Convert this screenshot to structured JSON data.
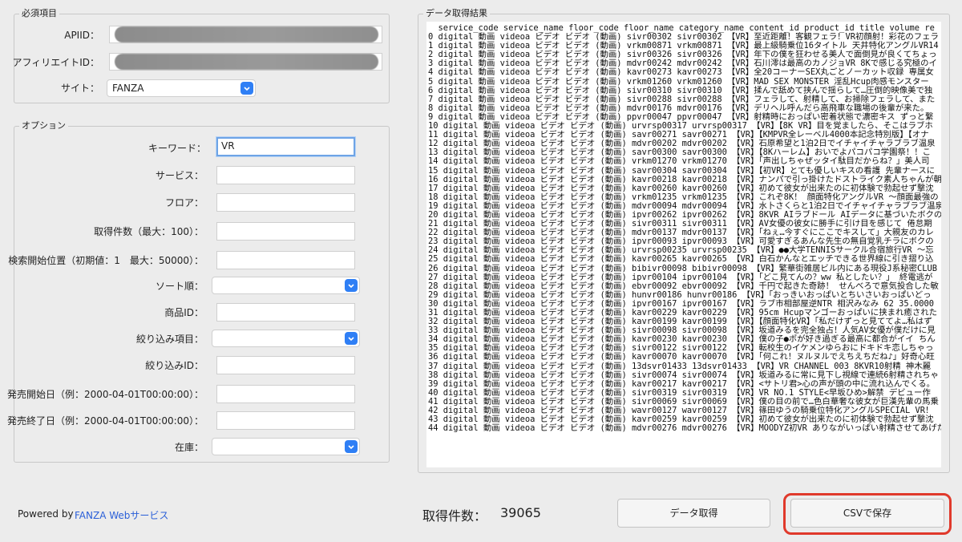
{
  "required": {
    "title": "必須項目",
    "apiid_label": "APIID：",
    "affiliate_label": "アフィリエイトID：",
    "site_label": "サイト：",
    "site_value": "FANZA"
  },
  "options": {
    "title": "オプション",
    "keyword_label": "キーワード：",
    "keyword_value": "VR",
    "service_label": "サービス：",
    "floor_label": "フロア：",
    "count_label": "取得件数（最大：100）：",
    "offset_label": "検索開始位置（初期値：1　最大：50000）：",
    "sort_label": "ソート順：",
    "product_id_label": "商品ID：",
    "filter_item_label": "絞り込み項目：",
    "filter_id_label": "絞り込みID：",
    "date_start_label": "発売開始日（例：2000-04-01T00:00:00）：",
    "date_end_label": "発売終了日（例：2000-04-01T00:00:00）：",
    "stock_label": "在庫："
  },
  "results": {
    "title": "データ取得結果",
    "header": "  service_code service_name floor_code floor_name category_name content_id product_id title volume re",
    "rows": [
      "0 digital 動画 videoa ビデオ ビデオ (動画) sivr00302 sivr00302 【VR】至近距離！客観フェラ！VR初顔射！彩花のフェラ",
      "1 digital 動画 videoa ビデオ ビデオ (動画) vrkm00871 vrkm00871 【VR】最上級騎乗位16タイトル 天井特化アングルVR14",
      "2 digital 動画 videoa ビデオ ビデオ (動画) sivr00326 sivr00326 【VR】年下の僕を狂わせる美人で面倒見が良くてちょっ",
      "3 digital 動画 videoa ビデオ ビデオ (動画) mdvr00242 mdvr00242 【VR】石川澪は最高のカノジョVR 8Kで感じる究極のイ",
      "4 digital 動画 videoa ビデオ ビデオ (動画) kavr00273 kavr00273 【VR】全20コーナーSEX丸ごとノーカット収録 専属女",
      "5 digital 動画 videoa ビデオ ビデオ (動画) vrkm01260 vrkm01260 【VR】MAD SEX MONSTER 淫乱Hcup肉感モンスター",
      "6 digital 動画 videoa ビデオ ビデオ (動画) sivr00310 sivr00310 【VR】揉んで舐めて挟んで揺らして…圧倒的映像美で独",
      "7 digital 動画 videoa ビデオ ビデオ (動画) sivr00288 sivr00288 【VR】フェラして、射精して、お掃除フェラして、また",
      "8 digital 動画 videoa ビデオ ビデオ (動画) mdvr00176 mdvr00176 【VR】デリヘル呼んだら高飛車な職場の後輩が来た。",
      "9 digital 動画 videoa ビデオ ビデオ (動画) ppvr00047 ppvr00047 【VR】射精時におっぱい密着状態で濃密キス ずっと繋",
      "10 digital 動画 videoa ビデオ ビデオ (動画) urvrsp00317 urvrsp00317 【VR】【8K VR】目を覚ましたら、そこはラブホ",
      "11 digital 動画 videoa ビデオ ビデオ (動画) savr00271 savr00271 【VR】【KMPVR全レーベル4000本記念特別版】【オナ",
      "12 digital 動画 videoa ビデオ ビデオ (動画) mdvr00202 mdvr00202 【VR】石原希望と1泊2日でイチャイチャラブラブ温泉",
      "13 digital 動画 videoa ビデオ ビデオ (動画) savr00300 savr00300 【VR】【8Kハーレム】おいでよパコパコ学園祭！！こ",
      "14 digital 動画 videoa ビデオ ビデオ (動画) vrkm01270 vrkm01270 【VR】「声出しちゃぜッタイ駄目だからね？」美人司",
      "15 digital 動画 videoa ビデオ ビデオ (動画) savr00304 savr00304 【VR】【初VR】とても優しいキスの看護 先輩ナースに",
      "16 digital 動画 videoa ビデオ ビデオ (動画) kavr00218 kavr00218 【VR】ナンパで引っ掛けたドストライク素人ちゃんが朝",
      "17 digital 動画 videoa ビデオ ビデオ (動画) kavr00260 kavr00260 【VR】初めて彼女が出来たのに初体験で勃起せず撃沈",
      "18 digital 動画 videoa ビデオ ビデオ (動画) vrkm01235 vrkm01235 【VR】これぞ8K！ 顔面特化アングルVR 〜顔面最強の",
      "19 digital 動画 videoa ビデオ ビデオ (動画) mdvr00094 mdvr00094 【VR】水卜さくらと1泊2日でイチャイチャラブラブ温泉",
      "20 digital 動画 videoa ビデオ ビデオ (動画) ipvr00262 ipvr00262 【VR】8KVR AIラブドール AIデータに基づいたボクの",
      "21 digital 動画 videoa ビデオ ビデオ (動画) sivr00311 sivr00311 【VR】AV女優の彼女に勝手に引け目を感じて 倦怠期",
      "22 digital 動画 videoa ビデオ ビデオ (動画) mdvr00137 mdvr00137 【VR】「ねぇ…今すぐにここでキスして」大親友のカレ",
      "23 digital 動画 videoa ビデオ ビデオ (動画) ipvr00093 ipvr00093 【VR】可愛すぎるあんな先生の無自覚乳チラにボクの",
      "24 digital 動画 videoa ビデオ ビデオ (動画) urvrsp00235 urvrsp00235 【VR】●●大学TENNISサークル合宿旅行VR 〜忘",
      "25 digital 動画 videoa ビデオ ビデオ (動画) kavr00265 kavr00265 【VR】白石かんなとエッチできる世界線に引き摺り込",
      "26 digital 動画 videoa ビデオ ビデオ (動画) bibivr00098 bibivr00098 【VR】繁華街雑居ビル内にある現役J系秘密CLUB",
      "27 digital 動画 videoa ビデオ ビデオ (動画) ipvr00104 ipvr00104 【VR】「どこ見てんの？ww 私としたい？」 終電逃が",
      "28 digital 動画 videoa ビデオ ビデオ (動画) ebvr00092 ebvr00092 【VR】千円で起きた奇跡！ せんべろで意気投合した敏",
      "29 digital 動画 videoa ビデオ ビデオ (動画) hunvr00186 hunvr00186 【VR】「おっきいおっぱいとちいさいおっぱいどっ",
      "30 digital 動画 videoa ビデオ ビデオ (動画) ipvr00167 ipvr00167 【VR】ラブ市相部屋逆NTR 相沢みなみ 62 35.0000",
      "31 digital 動画 videoa ビデオ ビデオ (動画) kavr00229 kavr00229 【VR】95cm Hcupマンゴーおっぱいに挟まれ癒された",
      "32 digital 動画 videoa ビデオ ビデオ (動画) kavr00199 kavr00199 【VR】【顔面特化VR】「私だけずっと見ててよ…私はず",
      "33 digital 動画 videoa ビデオ ビデオ (動画) sivr00098 sivr00098 【VR】坂道みるを完全独占！人気AV女優が僕だけに見",
      "34 digital 動画 videoa ビデオ ビデオ (動画) kavr00230 kavr00230 【VR】僕の子●ポが好き過ぎる最高に都合がイイ ちん",
      "35 digital 動画 videoa ビデオ ビデオ (動画) sivr00122 sivr00122 【VR】転校生のイケメンゆらおにドキドキ恋しちゃっ",
      "36 digital 動画 videoa ビデオ ビデオ (動画) kavr00070 kavr00070 【VR】「何これ！ヌルヌルでえちえちだね♪」好奇心旺",
      "37 digital 動画 videoa ビデオ ビデオ (動画) 13dsvr01433 13dsvr01433 【VR】VR CHANNEL 003 8KVR10射精 神木麗",
      "38 digital 動画 videoa ビデオ ビデオ (動画) sivr00074 sivr00074 【VR】坂道みるに常に見下し視線で連続6射精されちゃ",
      "39 digital 動画 videoa ビデオ ビデオ (動画) kavr00217 kavr00217 【VR】<サトリ君>心の声が頭の中に流れ込んでくる。",
      "40 digital 動画 videoa ビデオ ビデオ (動画) sivr00319 sivr00319 【VR】VR NO.1 STYLE<早坂ひめ>解禁 デビュー作",
      "41 digital 動画 videoa ビデオ ビデオ (動画) sivr00069 sivr00069 【VR】僕の目の前で…色白華奢な彼女が巨漢先輩の馬乗",
      "42 digital 動画 videoa ビデオ ビデオ (動画) wavr00127 wavr00127 【VR】篠田ゆうの騎乗位特化アングルSPECIAL VR！",
      "43 digital 動画 videoa ビデオ ビデオ (動画) kavr00259 kavr00259 【VR】初めて彼女が出来たのに初体験で勃起せず撃沈",
      "44 digital 動画 videoa ビデオ ビデオ (動画) mdvr00276 mdvr00276 【VR】MOODYZ初VR ありながいっぱい射精させてあげた"
    ]
  },
  "footer": {
    "powered_by": "Powered by",
    "powered_link": "FANZA Webサービス",
    "count_label": "取得件数：",
    "count_value": "39065",
    "fetch_button": "データ取得",
    "save_button": "CSVで保存"
  },
  "colors": {
    "accent": "#2f7ff5",
    "highlight": "#e0392b",
    "link": "#2a5fd8"
  }
}
